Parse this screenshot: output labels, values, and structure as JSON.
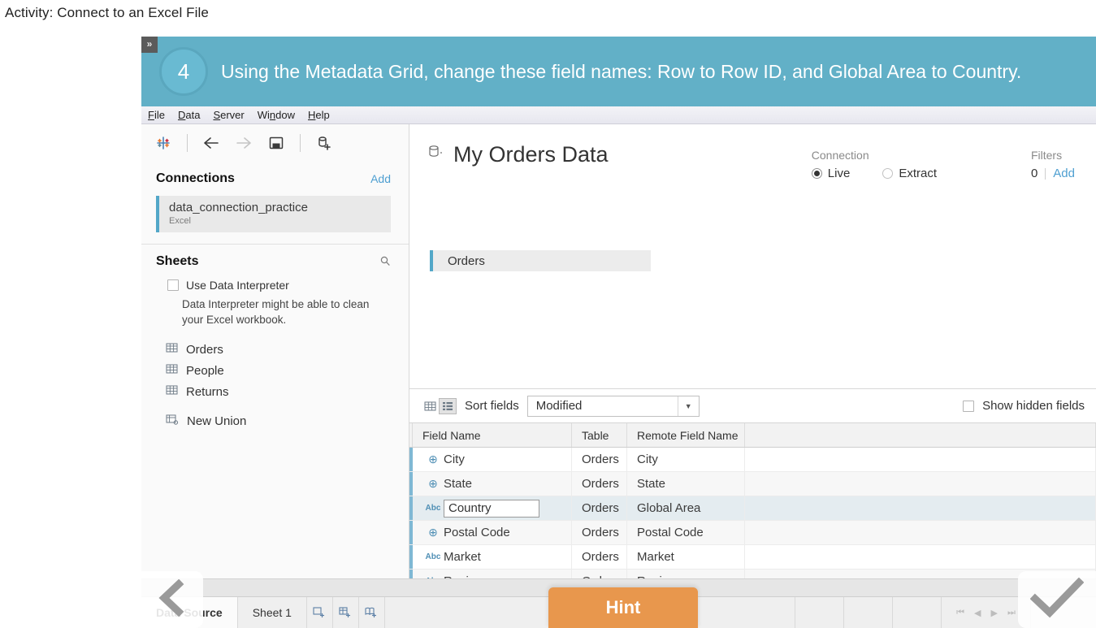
{
  "activity": {
    "title": "Activity: Connect to an Excel File"
  },
  "banner": {
    "collapse_icon": "double-chevron-right",
    "step_number": "4",
    "instruction": "Using the Metadata Grid, change these field names: Row to Row ID, and Global Area to Country.",
    "bg_color": "#62b0c7"
  },
  "menubar": {
    "items": [
      "File",
      "Data",
      "Server",
      "Window",
      "Help"
    ]
  },
  "toolbar": {
    "icons": [
      "tableau-logo-icon",
      "back-arrow-icon",
      "forward-arrow-icon",
      "save-icon",
      "new-data-source-icon"
    ]
  },
  "connections": {
    "title": "Connections",
    "add_label": "Add",
    "items": [
      {
        "name": "data_connection_practice",
        "type": "Excel"
      }
    ]
  },
  "sheets": {
    "title": "Sheets",
    "search_icon": "search-icon",
    "use_data_interpreter": {
      "label": "Use Data Interpreter",
      "checked": false,
      "hint": "Data Interpreter might be able to clean your Excel workbook."
    },
    "items": [
      "Orders",
      "People",
      "Returns"
    ],
    "new_union_label": "New Union"
  },
  "datasource": {
    "icon": "database-icon",
    "title": "My Orders Data",
    "canvas_table": "Orders"
  },
  "connection_panel": {
    "label": "Connection",
    "options": [
      "Live",
      "Extract"
    ],
    "selected": "Live"
  },
  "filters_panel": {
    "label": "Filters",
    "count": "0",
    "add_label": "Add"
  },
  "grid_toolbar": {
    "view_grid_icon": "grid-view-icon",
    "view_list_icon": "metadata-view-icon",
    "sort_label": "Sort fields",
    "sort_value": "Modified",
    "show_hidden_label": "Show hidden fields",
    "show_hidden_checked": false
  },
  "metadata_grid": {
    "columns": [
      "Field Name",
      "Table",
      "Remote Field Name",
      ""
    ],
    "rows": [
      {
        "type_icon": "geo",
        "type_label": "⊕",
        "field": "City",
        "table": "Orders",
        "remote": "City",
        "editing": false
      },
      {
        "type_icon": "geo",
        "type_label": "⊕",
        "field": "State",
        "table": "Orders",
        "remote": "State",
        "editing": false
      },
      {
        "type_icon": "abc",
        "type_label": "Abc",
        "field": "Country",
        "table": "Orders",
        "remote": "Global Area",
        "editing": true
      },
      {
        "type_icon": "geo",
        "type_label": "⊕",
        "field": "Postal Code",
        "table": "Orders",
        "remote": "Postal Code",
        "editing": false
      },
      {
        "type_icon": "abc",
        "type_label": "Abc",
        "field": "Market",
        "table": "Orders",
        "remote": "Market",
        "editing": false
      },
      {
        "type_icon": "abc",
        "type_label": "Abc",
        "field": "Region",
        "table": "Orders",
        "remote": "Region",
        "editing": false
      }
    ]
  },
  "bottom_bar": {
    "data_source_tab": "Data Source",
    "sheet_tab": "Sheet 1",
    "new_worksheet_icon": "new-worksheet-icon",
    "new_dashboard_icon": "new-dashboard-icon",
    "new_story_icon": "new-story-icon",
    "nav_first": "⏮",
    "nav_prev": "◀",
    "nav_next": "▶",
    "nav_last": "⏭"
  },
  "overlays": {
    "prev_nav_icon": "chevron-left-icon",
    "confirm_icon": "checkmark-icon",
    "hint_label": "Hint",
    "hint_color": "#e8974d"
  }
}
